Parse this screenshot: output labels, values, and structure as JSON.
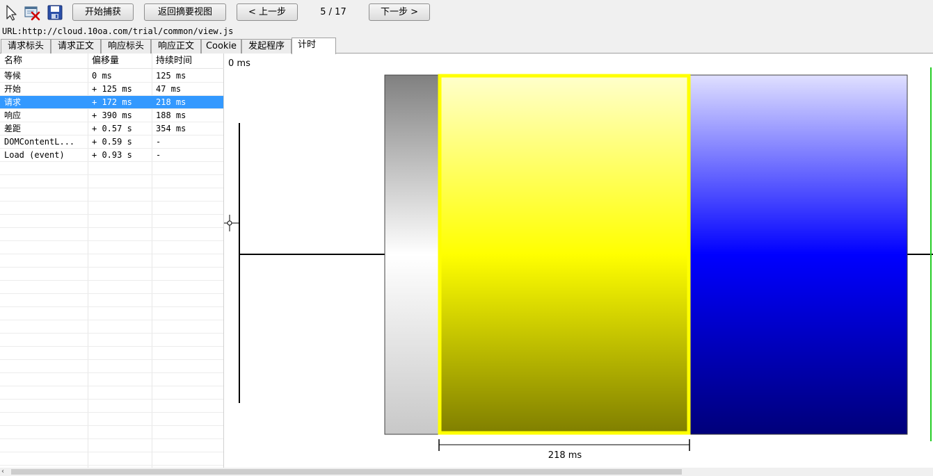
{
  "toolbar": {
    "icons": [
      "pointer-icon",
      "clear-capture-icon",
      "save-icon"
    ],
    "start_capture_label": "开始捕获",
    "back_to_summary_label": "返回摘要视图",
    "prev_label": "< 上一步",
    "counter": "5 / 17",
    "next_label": "下一步 >"
  },
  "url_bar": {
    "text": "URL:http://cloud.10oa.com/trial/common/view.js"
  },
  "tabs": [
    {
      "label": "请求标头"
    },
    {
      "label": "请求正文"
    },
    {
      "label": "响应标头"
    },
    {
      "label": "响应正文"
    },
    {
      "label": "Cookie"
    },
    {
      "label": "发起程序"
    },
    {
      "label": "计时",
      "active": true
    }
  ],
  "grid": {
    "headers": [
      "名称",
      "偏移量",
      "持续时间"
    ],
    "rows": [
      {
        "name": "等候",
        "offset": "0 ms",
        "duration": "125 ms"
      },
      {
        "name": "开始",
        "offset": "+ 125 ms",
        "duration": "47 ms"
      },
      {
        "name": "请求",
        "offset": "+ 172 ms",
        "duration": "218 ms",
        "selected": true
      },
      {
        "name": "响应",
        "offset": "+ 390 ms",
        "duration": "188 ms"
      },
      {
        "name": "差距",
        "offset": "+ 0.57 s",
        "duration": "354 ms"
      },
      {
        "name": "DOMContentL...",
        "offset": "+ 0.59 s",
        "duration": "-"
      },
      {
        "name": "Load (event)",
        "offset": "+ 0.93 s",
        "duration": "-"
      }
    ]
  },
  "timing_chart": {
    "origin_label": "0 ms",
    "selected_duration_label": "218 ms",
    "colors": {
      "start_segment": "#808080",
      "request_segment": "#ffff00",
      "response_segment": "#0000ff",
      "load_marker": "#22cc22"
    }
  }
}
